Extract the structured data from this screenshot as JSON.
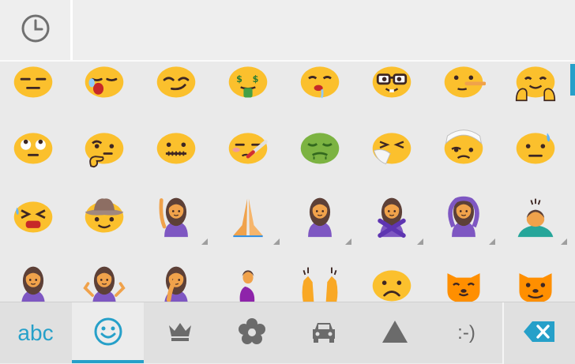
{
  "top_bar": {
    "recent_icon": "clock-icon"
  },
  "emoji_rows": [
    [
      {
        "name": "expressionless-face",
        "icon": "expressionless-face-icon"
      },
      {
        "name": "sleepy-face",
        "icon": "sleepy-face-icon"
      },
      {
        "name": "smirking-face",
        "icon": "smirking-face-icon"
      },
      {
        "name": "money-mouth-face",
        "icon": "money-mouth-face-icon"
      },
      {
        "name": "drooling-face",
        "icon": "drooling-face-icon"
      },
      {
        "name": "nerd-face",
        "icon": "nerd-face-icon"
      },
      {
        "name": "lying-face",
        "icon": "lying-face-icon"
      },
      {
        "name": "hugging-face",
        "icon": "hugging-face-icon"
      }
    ],
    [
      {
        "name": "face-rolling-eyes",
        "icon": "rolling-eyes-face-icon"
      },
      {
        "name": "thinking-face",
        "icon": "thinking-face-icon"
      },
      {
        "name": "zipper-mouth-face",
        "icon": "zipper-mouth-face-icon"
      },
      {
        "name": "face-with-thermometer",
        "icon": "thermometer-face-icon"
      },
      {
        "name": "nauseated-face",
        "icon": "nauseated-face-icon"
      },
      {
        "name": "sneezing-face",
        "icon": "sneezing-face-icon"
      },
      {
        "name": "face-with-head-bandage",
        "icon": "head-bandage-face-icon"
      },
      {
        "name": "face-with-cold-sweat",
        "icon": "cold-sweat-face-icon"
      }
    ],
    [
      {
        "name": "tired-face",
        "icon": "tired-face-icon"
      },
      {
        "name": "cowboy-hat-face",
        "icon": "cowboy-hat-face-icon"
      },
      {
        "name": "person-raising-hand",
        "icon": "person-raising-hand-icon",
        "variants": true
      },
      {
        "name": "folded-hands",
        "icon": "folded-hands-icon",
        "variants": true
      },
      {
        "name": "person-frowning",
        "icon": "person-frowning-icon",
        "variants": true
      },
      {
        "name": "person-gesturing-no",
        "icon": "person-gesturing-no-icon",
        "variants": true
      },
      {
        "name": "person-gesturing-ok",
        "icon": "person-gesturing-ok-icon",
        "variants": true
      },
      {
        "name": "person-bowing",
        "icon": "person-bowing-icon",
        "variants": true
      }
    ],
    [
      {
        "name": "person-standing",
        "icon": "person-standing-icon",
        "variants": true
      },
      {
        "name": "person-shrugging",
        "icon": "person-shrugging-icon",
        "variants": true
      },
      {
        "name": "person-facepalming",
        "icon": "person-facepalming-icon",
        "variants": true
      },
      {
        "name": "pregnant-woman",
        "icon": "pregnant-woman-icon",
        "variants": true
      },
      {
        "name": "raising-hands",
        "icon": "raising-hands-icon",
        "variants": true
      },
      {
        "name": "frowning-face",
        "icon": "frowning-face-icon"
      },
      {
        "name": "smiling-cat-face",
        "icon": "smiling-cat-face-icon"
      },
      {
        "name": "grinning-cat-face",
        "icon": "grinning-cat-face-icon"
      }
    ]
  ],
  "bottom_bar": {
    "abc_label": "abc",
    "emoticon_label": ":-)",
    "tabs": [
      {
        "name": "tab-abc",
        "icon": null
      },
      {
        "name": "tab-smileys",
        "icon": "smiley-icon",
        "selected": true
      },
      {
        "name": "tab-objects",
        "icon": "crown-icon"
      },
      {
        "name": "tab-nature",
        "icon": "flower-icon"
      },
      {
        "name": "tab-places",
        "icon": "car-icon"
      },
      {
        "name": "tab-symbols",
        "icon": "triangle-icon"
      },
      {
        "name": "tab-emoticons",
        "icon": null
      },
      {
        "name": "delete",
        "icon": "backspace-icon"
      }
    ]
  },
  "colors": {
    "accent": "#26a0c9",
    "emoji_yellow": "#fbc02d",
    "background": "#eeeeee",
    "bar": "#e0e0e0",
    "icon_gray": "#707070"
  }
}
